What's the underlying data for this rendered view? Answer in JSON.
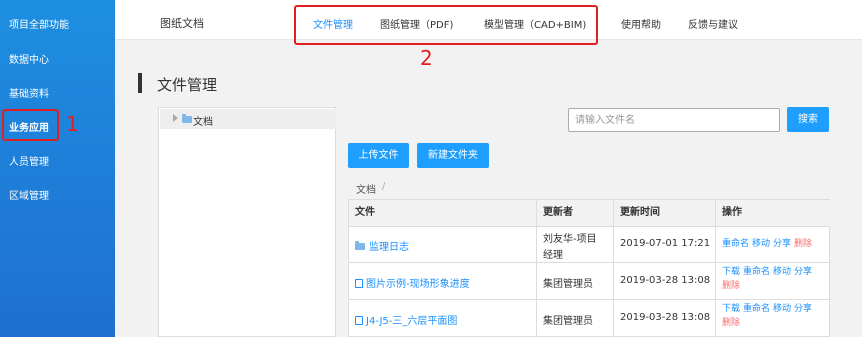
{
  "sidebar": {
    "items": [
      {
        "label": "项目全部功能"
      },
      {
        "label": "数据中心"
      },
      {
        "label": "基础资料"
      },
      {
        "label": "业务应用"
      },
      {
        "label": "人员管理"
      },
      {
        "label": "区域管理"
      }
    ]
  },
  "annotations": {
    "sidebar_marker": "1",
    "tabs_marker": "2"
  },
  "topbar": {
    "brand": "图纸文档",
    "tabs": [
      {
        "label": "文件管理"
      },
      {
        "label": "图纸管理（PDF)"
      },
      {
        "label": "模型管理（CAD+BIM)"
      },
      {
        "label": "使用帮助"
      },
      {
        "label": "反馈与建议"
      }
    ]
  },
  "page": {
    "title": "文件管理"
  },
  "tree": {
    "root_label": "文档"
  },
  "search": {
    "placeholder": "请输入文件名",
    "button_label": "搜索"
  },
  "toolbar": {
    "upload_label": "上传文件",
    "new_folder_label": "新建文件夹"
  },
  "breadcrumb": {
    "root": "文档",
    "separator": "/"
  },
  "table": {
    "headers": {
      "file": "文件",
      "updater": "更新者",
      "time": "更新时间",
      "actions": "操作"
    },
    "rows": [
      {
        "name": "监理日志",
        "updater_line1": "刘友华-项目",
        "updater_line2": "经理",
        "time": "2019-07-01 17:21",
        "actions": [
          "重命名",
          "移动",
          "分享",
          "删除"
        ]
      },
      {
        "name": "图片示例-现场形象进度",
        "updater": "集团管理员",
        "time": "2019-03-28 13:08",
        "actions": [
          "下载",
          "重命名",
          "移动",
          "分享",
          "删除"
        ]
      },
      {
        "name": "J4-J5-三_六层平面图",
        "updater": "集团管理员",
        "time": "2019-03-28 13:08",
        "actions": [
          "下载",
          "重命名",
          "移动",
          "分享",
          "删除"
        ]
      }
    ]
  },
  "colors": {
    "sidebar": "#1e7fd8",
    "accent": "#1e9fff",
    "tab_active": "#1890ff",
    "delete": "#ff6b6b",
    "annotation": "#e02020"
  }
}
